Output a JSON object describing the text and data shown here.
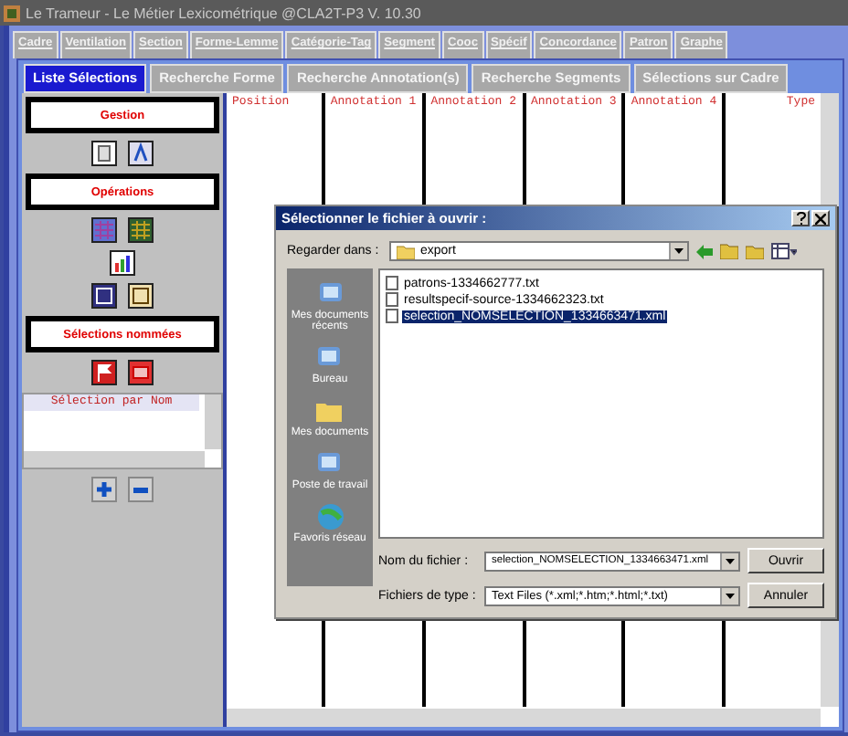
{
  "window": {
    "title": "Le Trameur - Le Métier Lexicométrique @CLA2T-P3 V. 10.30"
  },
  "main_tabs": [
    {
      "label": "Cadre",
      "selected": false
    },
    {
      "label": "Ventilation",
      "selected": false
    },
    {
      "label": "Section",
      "selected": false
    },
    {
      "label": "Forme-Lemme",
      "selected": false
    },
    {
      "label": "Catégorie-Tag",
      "selected": false
    },
    {
      "label": "Segment",
      "selected": false
    },
    {
      "label": "Cooc",
      "selected": false
    },
    {
      "label": "Spécif",
      "selected": false
    },
    {
      "label": "Concordance",
      "selected": false
    },
    {
      "label": "Patron",
      "selected": false
    },
    {
      "label": "Graphe",
      "selected": false
    }
  ],
  "sub_tabs": [
    {
      "label": "Liste Sélections",
      "selected": true
    },
    {
      "label": "Recherche Forme",
      "selected": false
    },
    {
      "label": "Recherche Annotation(s)",
      "selected": false
    },
    {
      "label": "Recherche Segments",
      "selected": false
    },
    {
      "label": "Sélections sur Cadre",
      "selected": false
    }
  ],
  "sidebar": {
    "sections": [
      "Gestion",
      "Opérations",
      "Sélections nommées"
    ],
    "list_header": "Sélection par Nom"
  },
  "table": {
    "columns": [
      "Position",
      "Annotation 1",
      "Annotation 2",
      "Annotation 3",
      "Annotation 4",
      "Type"
    ]
  },
  "dialog": {
    "title": "Sélectionner le fichier à ouvrir :",
    "look_in_label": "Regarder dans :",
    "look_in_value": "export",
    "places": [
      "Mes documents récents",
      "Bureau",
      "Mes documents",
      "Poste de travail",
      "Favoris réseau"
    ],
    "files": [
      {
        "name": "patrons-1334662777.txt",
        "selected": false
      },
      {
        "name": "resultspecif-source-1334662323.txt",
        "selected": false
      },
      {
        "name": "selection_NOMSELECTION_1334663471.xml",
        "selected": true
      }
    ],
    "file_name_label": "Nom du fichier :",
    "file_name_value": "selection_NOMSELECTION_1334663471.xml",
    "file_type_label": "Fichiers de type :",
    "file_type_value": "Text Files (*.xml;*.htm;*.html;*.txt)",
    "buttons": [
      "Ouvrir",
      "Annuler"
    ]
  }
}
